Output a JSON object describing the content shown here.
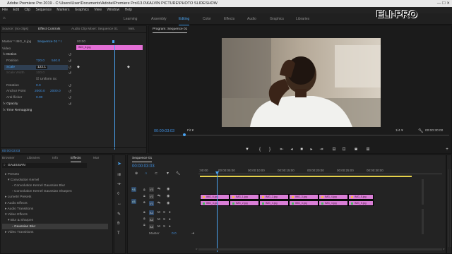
{
  "window": {
    "title": "Adobe Premiere Pro 2019 - C:\\Users\\User\\Documents\\Adobe\\Premiere Pro\\13.0\\KALVIN PICTURE\\PHOTO SLIDESHOW"
  },
  "menu": [
    "File",
    "Edit",
    "Clip",
    "Sequence",
    "Markers",
    "Graphics",
    "View",
    "Window",
    "Help"
  ],
  "workspaces": [
    "Learning",
    "Assembly",
    "Editing",
    "Color",
    "Effects",
    "Audio",
    "Graphics",
    "Libraries"
  ],
  "active_workspace": "Editing",
  "watermark": "ELI-PRO",
  "source_tabs": [
    "Source: (no clips)",
    "Effect Controls",
    "Audio Clip Mixer: Sequence 01",
    "Met."
  ],
  "effect_controls": {
    "master": "Master * IMG_6.jpg",
    "sequence": "Sequence 01 * I",
    "time_start": "00:00",
    "clip": "IMG_6.jpg",
    "video_header": "Video",
    "fx": [
      {
        "label": "fx",
        "name": "Motion"
      },
      {
        "name": "Position",
        "v1": "720.0",
        "v2": "540.0"
      },
      {
        "name": "Scale",
        "v1": "122.1"
      },
      {
        "name": "Scale Width",
        "v1": "100.0"
      },
      {
        "name": "Uniform Sc"
      },
      {
        "name": "Rotation",
        "v1": "0.0"
      },
      {
        "name": "Anchor Point",
        "v1": "2000.0",
        "v2": "2000.0"
      },
      {
        "name": "Anti-flicker",
        "v1": "0.00"
      },
      {
        "label": "fx",
        "name": "Opacity"
      },
      {
        "label": "fx",
        "name": "Time Remapping"
      }
    ],
    "time": "00:00:03:03"
  },
  "program": {
    "title": "Program: Sequence 01",
    "timecode": "00:00:03:03",
    "fit": "Fit",
    "ratio": "1/4",
    "duration": "00:00:30:00"
  },
  "effects_panel": {
    "tabs": [
      "Browser",
      "Libraries",
      "Info",
      "Effects",
      "Mar"
    ],
    "search": "GAUSSIAN",
    "items": [
      {
        "label": "Presets",
        "indent": 0
      },
      {
        "label": "Convolution Kernel",
        "indent": 1
      },
      {
        "label": "Convolution Kernel Gaussian Blur",
        "indent": 2
      },
      {
        "label": "Convolution Kernel Gaussian Sharpen",
        "indent": 2
      },
      {
        "label": "Lumetri Presets",
        "indent": 0
      },
      {
        "label": "Audio Effects",
        "indent": 0
      },
      {
        "label": "Audio Transitions",
        "indent": 0
      },
      {
        "label": "Video Effects",
        "indent": 0
      },
      {
        "label": "Blur & Sharpen",
        "indent": 1
      },
      {
        "label": "Gaussian Blur",
        "indent": 2,
        "selected": true
      },
      {
        "label": "Video Transitions",
        "indent": 0
      }
    ]
  },
  "timeline": {
    "tab": "Sequence 01",
    "timecode": "00:00:03:03",
    "ruler": [
      ":00:00",
      "00:00:05:00",
      "00:00:10:00",
      "00:00:15:00",
      "00:00:20:00",
      "00:00:25:00",
      "00:00:30:00"
    ],
    "tracks": [
      "V3",
      "V2",
      "V1",
      "A1",
      "A2",
      "A3",
      "Master"
    ],
    "master_value": "0.0",
    "clips_upper": [
      "IMG_6.jpg",
      "IMG_1.jpg",
      "IMG_2.jpg",
      "IMG_3.jpg",
      "IMG_4.jpg",
      "IMG_5.jpg"
    ],
    "clips_lower": [
      "IMG_3.jpg",
      "IMG_2.jpg",
      "IMG_3.jpg",
      "IMG_3.jpg",
      "IMG_4.jpg",
      "IMG_5.jpg"
    ]
  },
  "colors": {
    "accent": "#4aa3f0",
    "clip": "#d97ed6",
    "timecode": "#3f8fe0"
  }
}
